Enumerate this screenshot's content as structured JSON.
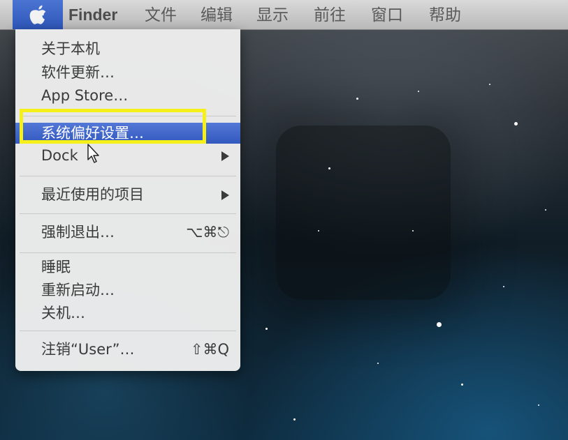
{
  "menubar": {
    "apple_icon": "apple-logo",
    "items": [
      {
        "label": "Finder"
      },
      {
        "label": "文件"
      },
      {
        "label": "编辑"
      },
      {
        "label": "显示"
      },
      {
        "label": "前往"
      },
      {
        "label": "窗口"
      },
      {
        "label": "帮助"
      }
    ]
  },
  "apple_menu": {
    "items": [
      {
        "label": "关于本机"
      },
      {
        "label": "软件更新…"
      },
      {
        "label": "App Store…"
      },
      {
        "label": "系统偏好设置…",
        "state": "highlighted"
      },
      {
        "label": "Dock",
        "submenu": true
      },
      {
        "label": "最近使用的项目",
        "submenu": true
      },
      {
        "label": "强制退出…",
        "shortcut": "⌥⌘⎋"
      },
      {
        "label": "睡眠"
      },
      {
        "label": "重新启动…"
      },
      {
        "label": "关机…"
      },
      {
        "label": "注销“User”…",
        "shortcut": "⇧⌘Q"
      }
    ]
  },
  "annotation": {
    "color": "#f5ef1a"
  },
  "colors": {
    "highlight": "#3f67c9",
    "apple_button": "#3a62c4"
  }
}
